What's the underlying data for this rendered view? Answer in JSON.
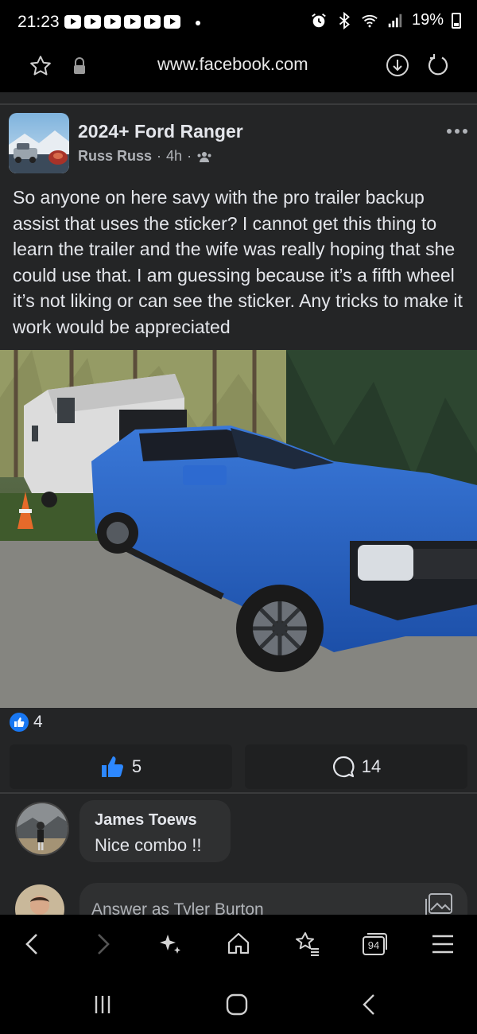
{
  "status_bar": {
    "time": "21:23",
    "battery": "19%"
  },
  "browser": {
    "url": "www.facebook.com",
    "tabs_count": "94"
  },
  "post": {
    "group_name": "2024+ Ford Ranger",
    "author": "Russ Russ",
    "time": "4h",
    "text": "So anyone on here savy with the pro trailer backup assist that uses the sticker? I cannot get this thing to learn the trailer and the wife was really hoping that she could use that. I am guessing because it’s a fifth wheel it’s not liking or can see the sticker. Any tricks to make it work would be appreciated",
    "reaction_count": "4",
    "like_count": "5",
    "comment_count": "14"
  },
  "comment": {
    "author": "James Toews",
    "text": "Nice combo !!"
  },
  "reply": {
    "placeholder": "Answer as Tyler Burton"
  },
  "colors": {
    "accent": "#1877f2",
    "card_bg": "#242526",
    "bubble_bg": "#2f3031",
    "secondary_text": "#b0b3b8"
  }
}
